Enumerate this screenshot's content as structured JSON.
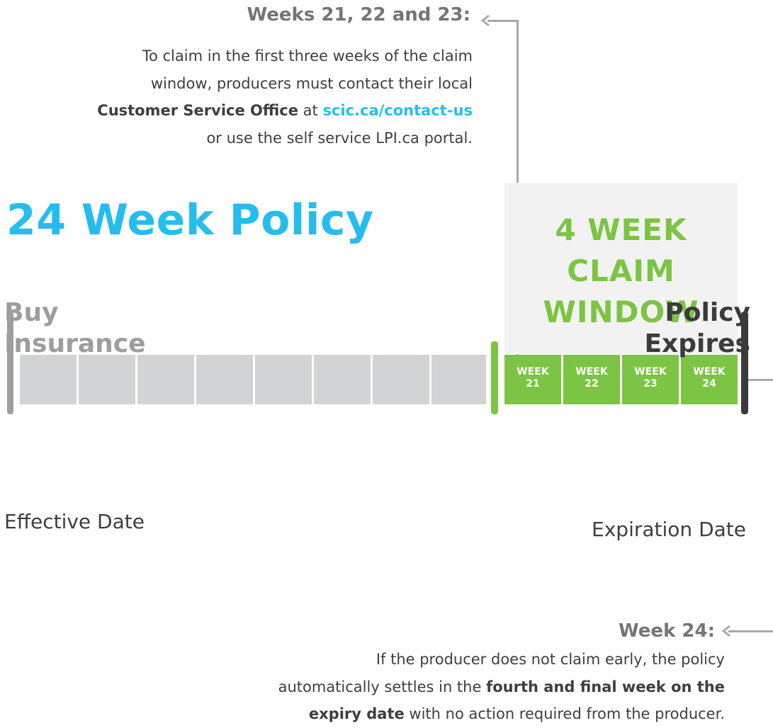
{
  "top_note": {
    "heading": "Weeks 21, 22 and 23:",
    "line_1": "To claim in the first three weeks of the claim",
    "line_2": "window, producers must contact their local",
    "bold_office": "Customer Service Office",
    "at_word": " at ",
    "link_text": "scic.ca/contact-us",
    "line_4": "or use the self service LPI.ca portal."
  },
  "policy_title": "24 Week Policy",
  "claim_window": {
    "title_line_1": "4 WEEK",
    "title_line_2": "CLAIM",
    "title_line_3": "WINDOW"
  },
  "timeline": {
    "total_weeks": 24,
    "claim_weeks": [
      {
        "word": "WEEK",
        "number": "21"
      },
      {
        "word": "WEEK",
        "number": "22"
      },
      {
        "word": "WEEK",
        "number": "23"
      },
      {
        "word": "WEEK",
        "number": "24"
      }
    ]
  },
  "start": {
    "title_line_1": "Buy",
    "title_line_2": "Insurance",
    "subtitle": "Effective Date"
  },
  "end": {
    "title_line_1": "Policy",
    "title_line_2": "Expires",
    "subtitle": "Expiration Date"
  },
  "bottom_note": {
    "heading": "Week 24:",
    "line_1": "If the producer does not claim early, the policy",
    "line_2_plain": "automatically settles in the ",
    "line_2_bold": "fourth and final week on the",
    "line_3_bold": "expiry date",
    "line_3_plain": " with no action required from the producer."
  },
  "colors": {
    "policy_blue": "#26bdec",
    "claim_green": "#7cc443",
    "timeline_grey": "#d1d3d4",
    "claim_box_bg": "#f2f2f2",
    "heading_grey": "#757575",
    "text_dark": "#3e3e3e"
  }
}
